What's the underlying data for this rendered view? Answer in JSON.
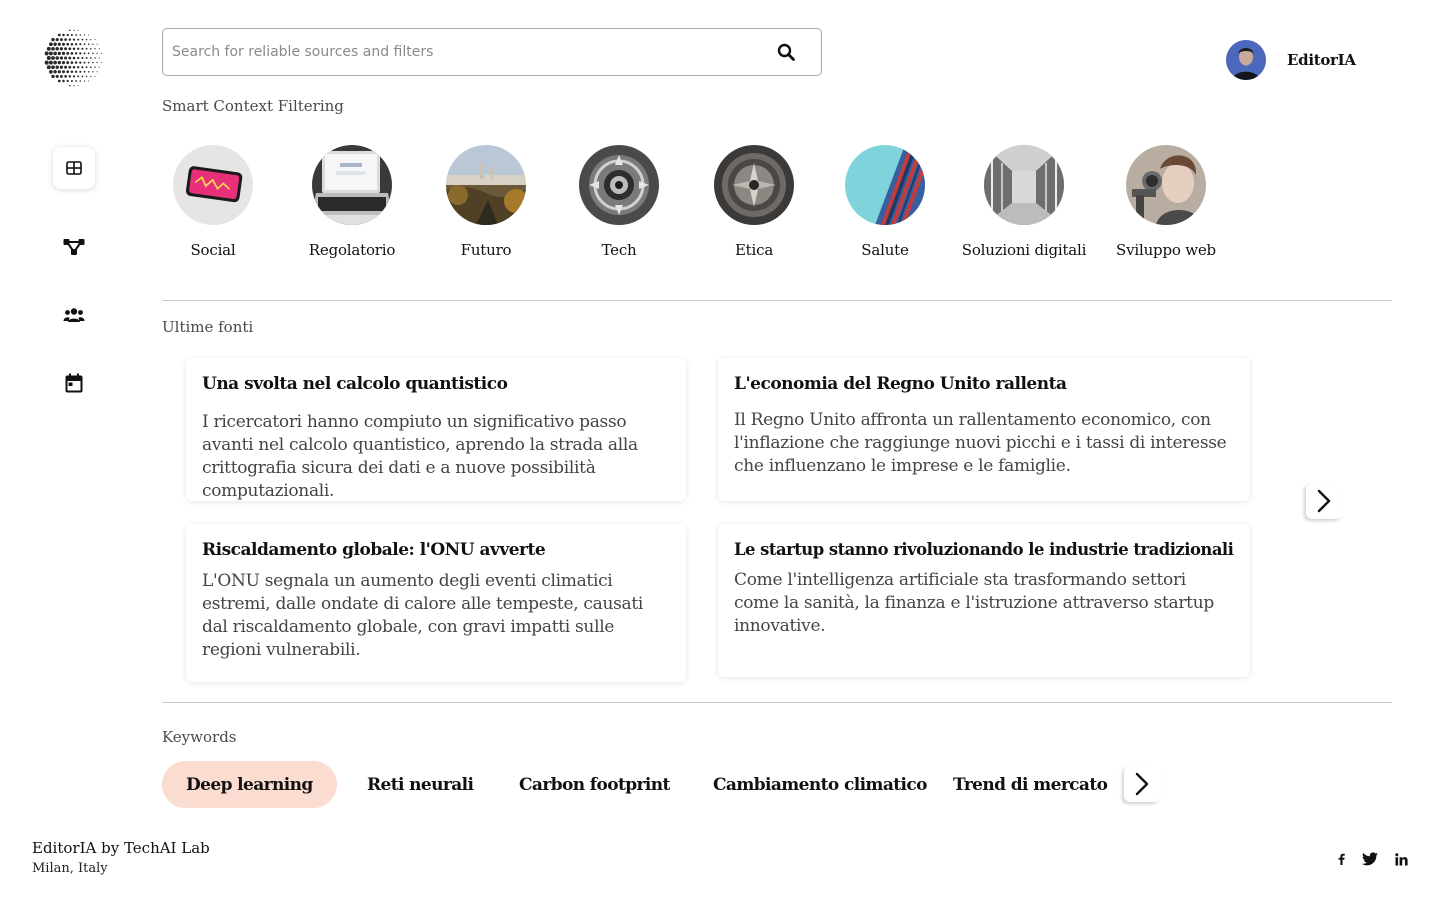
{
  "app": {
    "username": "EditorIA"
  },
  "search": {
    "placeholder": "Search for reliable sources and filters"
  },
  "sidebar": {
    "items": [
      "dashboard-icon",
      "network-icon",
      "users-icon",
      "calendar-icon"
    ]
  },
  "smart_context": {
    "title": "Smart Context Filtering",
    "categories": [
      {
        "label": "Social"
      },
      {
        "label": "Regolatorio"
      },
      {
        "label": "Futuro"
      },
      {
        "label": "Tech"
      },
      {
        "label": "Etica"
      },
      {
        "label": "Salute"
      },
      {
        "label": "Soluzioni digitali"
      },
      {
        "label": "Sviluppo web"
      }
    ]
  },
  "sources": {
    "title": "Ultime fonti",
    "cards": [
      {
        "title": "Una svolta nel calcolo quantistico",
        "text": "I ricercatori hanno compiuto un significativo passo avanti nel calcolo quantistico, aprendo la strada alla crittografia sicura dei dati e a nuove possibilità computazionali."
      },
      {
        "title": "L'economia del Regno Unito rallenta",
        "text": "Il Regno Unito affronta un rallentamento economico, con l'inflazione che raggiunge nuovi picchi e i tassi di interesse che influenzano le imprese e le famiglie."
      },
      {
        "title": "Riscaldamento globale: l'ONU avverte",
        "text": "L'ONU segnala un aumento degli eventi climatici estremi, dalle ondate di calore alle tempeste, causati dal riscaldamento globale, con gravi impatti sulle regioni vulnerabili."
      },
      {
        "title": "Le startup stanno rivoluzionando le industrie tradizionali",
        "text": "Come l'intelligenza artificiale sta trasformando settori come la sanità, la finanza e l'istruzione attraverso startup innovative."
      }
    ]
  },
  "keywords": {
    "title": "Keywords",
    "items": [
      "Deep learning",
      "Reti neurali",
      "Carbon footprint",
      "Cambiamento climatico",
      "Trend di mercato"
    ],
    "active_color": "#fbdcd0"
  },
  "footer": {
    "brand": "EditorIA by TechAI Lab",
    "location": "Milan, Italy",
    "social": [
      "facebook-icon",
      "twitter-icon",
      "linkedin-icon"
    ]
  }
}
